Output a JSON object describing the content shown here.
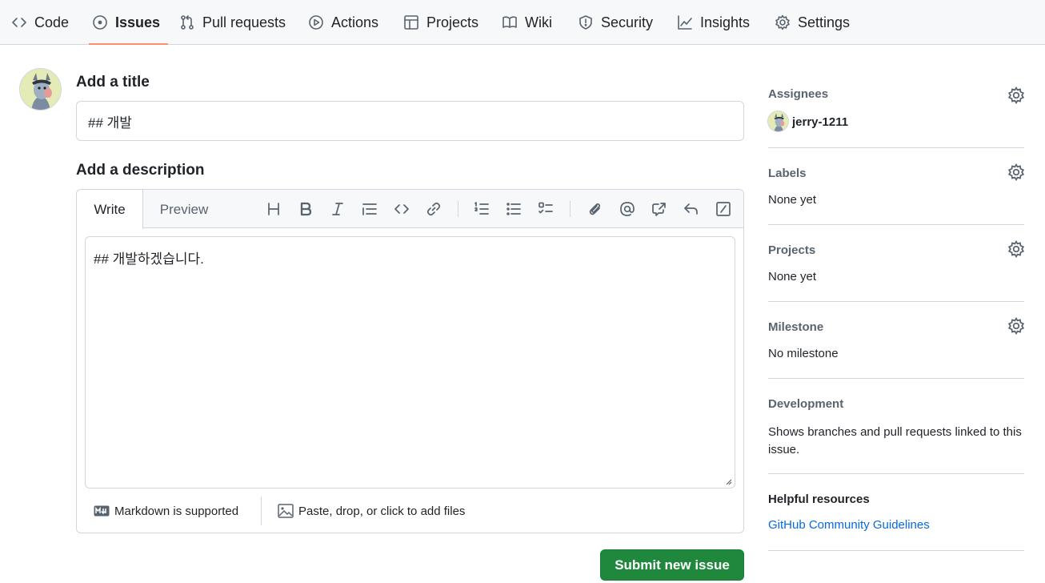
{
  "nav": {
    "tabs": [
      {
        "label": "Code",
        "icon": "code-icon"
      },
      {
        "label": "Issues",
        "icon": "issue-opened-icon",
        "active": true
      },
      {
        "label": "Pull requests",
        "icon": "git-pull-request-icon"
      },
      {
        "label": "Actions",
        "icon": "play-icon"
      },
      {
        "label": "Projects",
        "icon": "table-icon"
      },
      {
        "label": "Wiki",
        "icon": "book-icon"
      },
      {
        "label": "Security",
        "icon": "shield-icon"
      },
      {
        "label": "Insights",
        "icon": "graph-icon"
      },
      {
        "label": "Settings",
        "icon": "gear-icon"
      }
    ]
  },
  "form": {
    "title_label": "Add a title",
    "title_value": "## 개발",
    "description_label": "Add a description",
    "tabs": {
      "write": "Write",
      "preview": "Preview"
    },
    "body_value": "## 개발하겠습니다.",
    "markdown_note": "Markdown is supported",
    "files_note": "Paste, drop, or click to add files",
    "submit_label": "Submit new issue"
  },
  "sidebar": {
    "assignees": {
      "heading": "Assignees",
      "user": "jerry-1211"
    },
    "labels": {
      "heading": "Labels",
      "value": "None yet"
    },
    "projects": {
      "heading": "Projects",
      "value": "None yet"
    },
    "milestone": {
      "heading": "Milestone",
      "value": "No milestone"
    },
    "development": {
      "heading": "Development",
      "value": "Shows branches and pull requests linked to this issue."
    },
    "helpful": {
      "heading": "Helpful resources",
      "link": "GitHub Community Guidelines"
    }
  },
  "colors": {
    "accent_underline": "#fd8c73",
    "submit_green": "#1f883d",
    "link_blue": "#0969da"
  }
}
